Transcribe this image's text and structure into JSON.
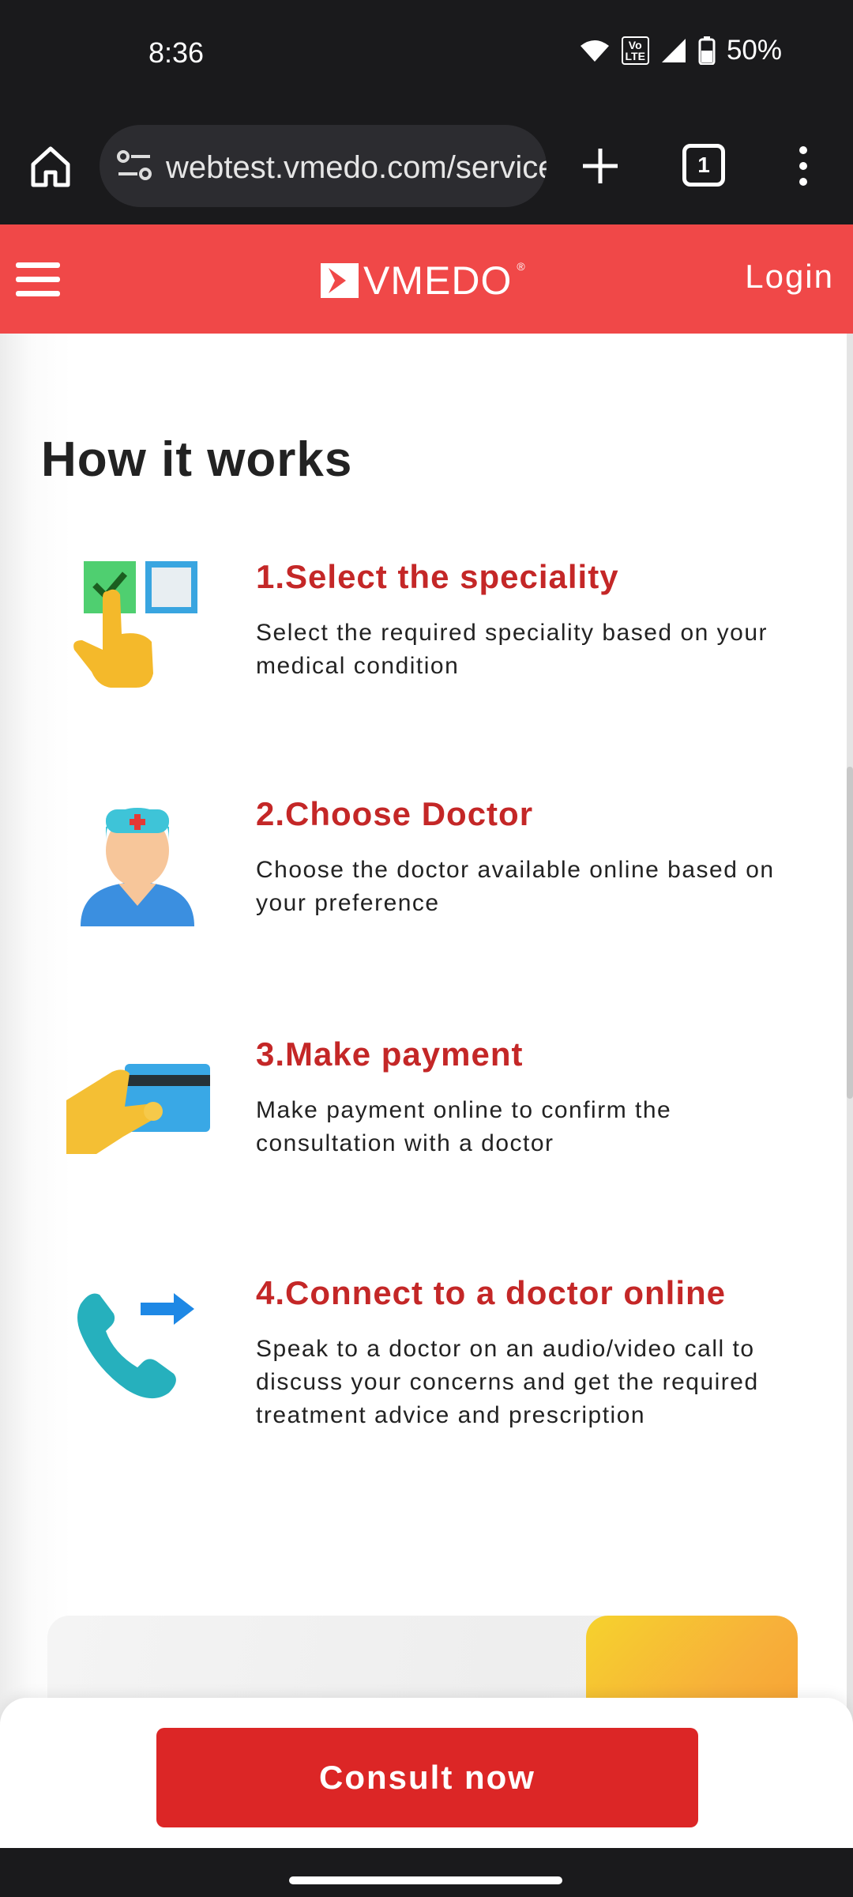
{
  "status": {
    "time": "8:36",
    "volte": "Vo\nLTE",
    "battery": "50%"
  },
  "browser": {
    "url": "webtest.vmedo.com/services",
    "tab_count": "1"
  },
  "site": {
    "logo_text": "VMEDO",
    "logo_reg": "®",
    "login_label": "Login"
  },
  "section": {
    "title": "How it works",
    "steps": [
      {
        "title": "1.Select the speciality",
        "desc": "Select the required speciality based on your medical condition",
        "icon": "select-speciality-icon"
      },
      {
        "title": "2.Choose Doctor",
        "desc": "Choose the doctor available online based on your preference",
        "icon": "doctor-icon"
      },
      {
        "title": "3.Make payment",
        "desc": "Make payment online to confirm the consultation with a doctor",
        "icon": "payment-card-icon"
      },
      {
        "title": "4.Connect to a doctor online",
        "desc": "Speak to a doctor on an audio/video call to discuss your concerns and get the required treatment advice and prescription",
        "icon": "phone-call-icon"
      }
    ]
  },
  "cta": {
    "label": "Consult now"
  },
  "colors": {
    "brand": "#f04848",
    "accent_text": "#c42727",
    "button": "#dc2626"
  }
}
